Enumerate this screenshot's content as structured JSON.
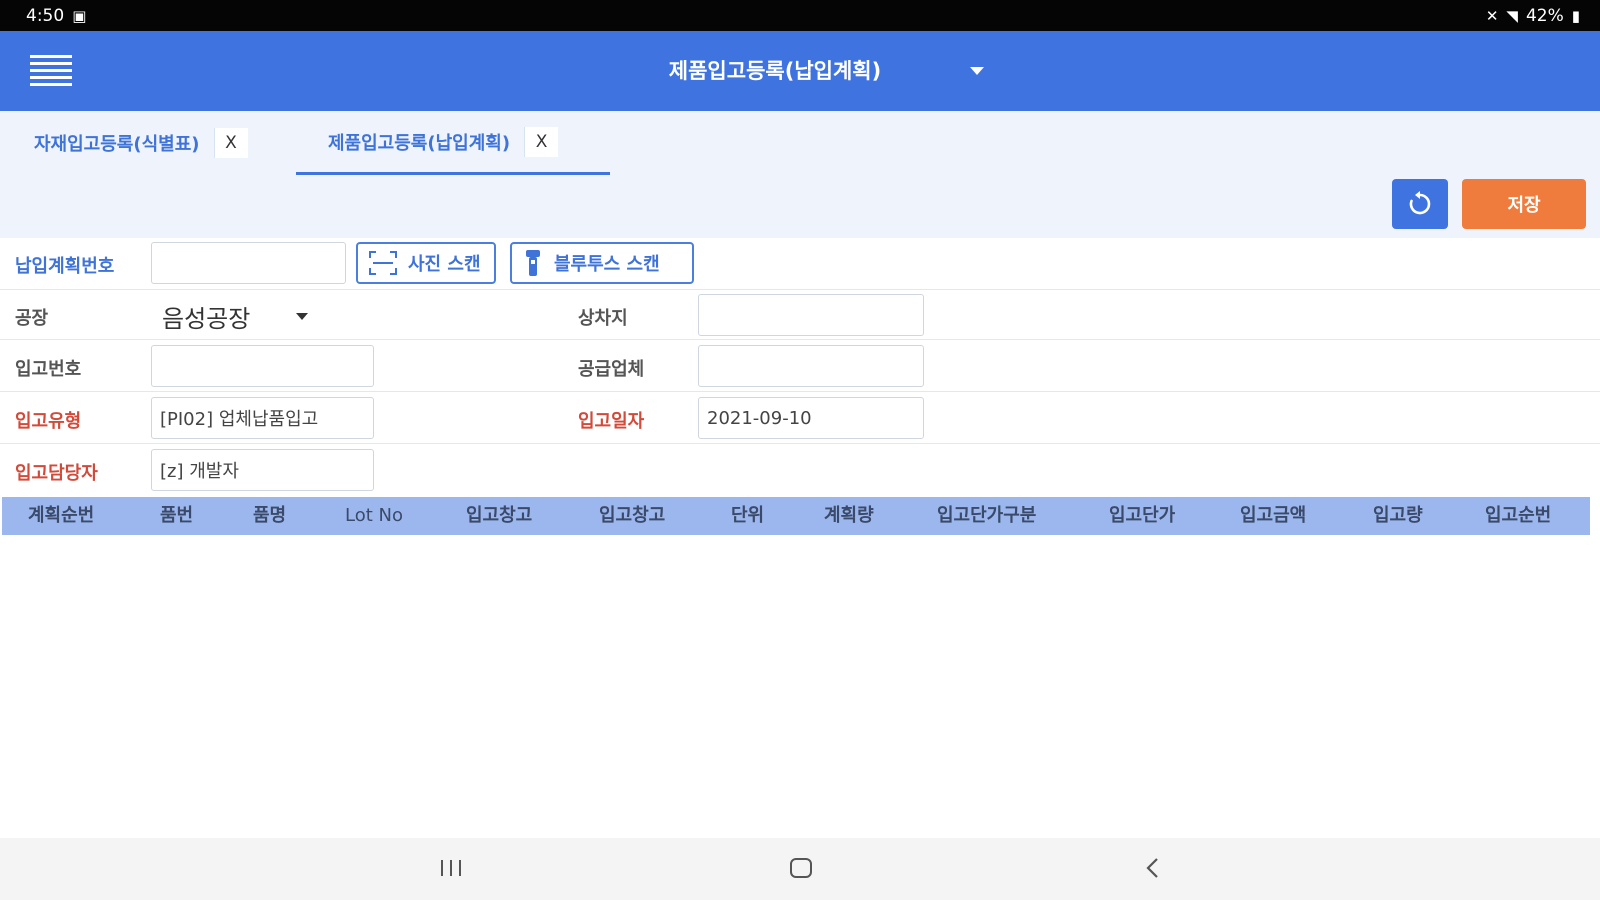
{
  "status_bar": {
    "time": "4:50",
    "battery": "42%"
  },
  "app_bar": {
    "title": "제품입고등록(납입계획)"
  },
  "tabs": [
    {
      "label": "자재입고등록(식별표)",
      "close": "X"
    },
    {
      "label": "제품입고등록(납입계획)",
      "close": "X"
    }
  ],
  "toolbar": {
    "save_label": "저장"
  },
  "form": {
    "delivery_plan_no": {
      "label": "납입계획번호",
      "value": ""
    },
    "photo_scan_label": "사진 스캔",
    "bluetooth_scan_label": "블루투스 스캔",
    "factory": {
      "label": "공장",
      "value": "음성공장"
    },
    "loading_place": {
      "label": "상차지",
      "value": ""
    },
    "receipt_no": {
      "label": "입고번호",
      "value": ""
    },
    "supplier": {
      "label": "공급업체",
      "value": ""
    },
    "receipt_type": {
      "label": "입고유형",
      "value": "[PI02] 업체납품입고"
    },
    "receipt_date": {
      "label": "입고일자",
      "value": "2021-09-10"
    },
    "receipt_manager": {
      "label": "입고담당자",
      "value": "[z] 개발자"
    }
  },
  "grid": {
    "columns": [
      "계획순번",
      "품번",
      "품명",
      "Lot No",
      "입고창고",
      "입고창고",
      "단위",
      "계획량",
      "입고단가구분",
      "입고단가",
      "입고금액",
      "입고량",
      "입고순번"
    ]
  },
  "colors": {
    "primary": "#3e73e0",
    "save": "#ef7c3c",
    "required_label": "#d24a3a",
    "grid_header": "#9cb7ee"
  }
}
